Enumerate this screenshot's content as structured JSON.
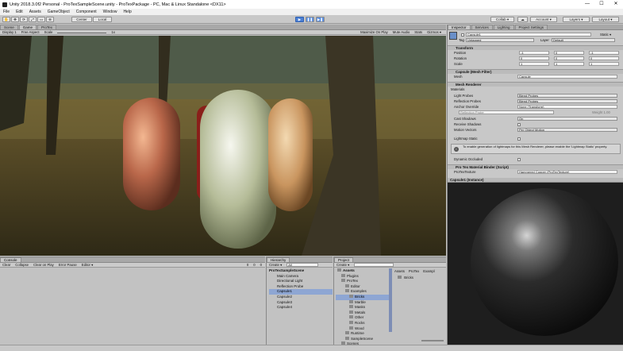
{
  "window": {
    "title": "Unity 2018.3.0f2 Personal - ProTexSampleScene.unity - ProTexPackage - PC, Mac & Linux Standalone <DX11>",
    "minimize": "—",
    "maximize": "☐",
    "close": "✕"
  },
  "menu": [
    "File",
    "Edit",
    "Assets",
    "GameObject",
    "Component",
    "Window",
    "Help"
  ],
  "toolbar": {
    "pivot": "Center",
    "space": "Local",
    "collab": "Collab ▾",
    "account": "Account ▾",
    "layers": "Layers ▾",
    "layout": "Layout ▾"
  },
  "scene_tabs": [
    "Scene",
    "Game",
    "ProTex"
  ],
  "game_bar": {
    "display": "Display 1",
    "aspect": "Free Aspect",
    "scale_label": "Scale",
    "scale_value": "1x",
    "maximize": "Maximize On Play",
    "mute": "Mute Audio",
    "stats": "Stats",
    "gizmos": "Gizmos ▾"
  },
  "inspector": {
    "tabs": [
      "Inspector",
      "Services",
      "Lighting",
      "Project Settings"
    ],
    "object_name": "Capsule1",
    "static": "Static ▾",
    "tag_label": "Tag",
    "tag_value": "Untagged",
    "layer_label": "Layer",
    "layer_value": "Default",
    "transform": {
      "title": "Transform",
      "rows": [
        {
          "label": "Position",
          "x": "-1",
          "y": "0",
          "z": "-1"
        },
        {
          "label": "Rotation",
          "x": "0",
          "y": "0",
          "z": "0"
        },
        {
          "label": "Scale",
          "x": "1",
          "y": "1",
          "z": "1"
        }
      ]
    },
    "mesh_filter": {
      "title": "Capsule (Mesh Filter)",
      "mesh_label": "Mesh",
      "mesh_value": "Capsule"
    },
    "mesh_renderer": {
      "title": "Mesh Renderer",
      "materials": "Materials",
      "rows": [
        {
          "label": "Light Probes",
          "value": "Blend Probes"
        },
        {
          "label": "Reflection Probes",
          "value": "Blend Probes"
        },
        {
          "label": "Anchor Override",
          "value": "None (Transform)"
        },
        {
          "label": "Cast Shadows",
          "value": "On"
        },
        {
          "label": "Receive Shadows",
          "value": ""
        },
        {
          "label": "Motion Vectors",
          "value": "Per Object Motion"
        },
        {
          "label": "Lightmap Static",
          "value": ""
        }
      ],
      "probe_label": "Reflection Probe",
      "probe_value": "Weight 1.00",
      "info": "To enable generation of lightmaps for this Mesh Renderer, please enable the 'Lightmap Static' property.",
      "dynamic_occluded": "Dynamic Occluded"
    },
    "protex": {
      "title": "Pro Tex Material Binder (Script)",
      "field_label": "ProTexTexture",
      "field_value": "Hammered Copper (ProTexTexture)"
    },
    "preview_title": "Capsule1 (Instance)"
  },
  "console": {
    "tab": "Console",
    "buttons": [
      "Clear",
      "Collapse",
      "Clear on Play",
      "Error Pause",
      "Editor ▾"
    ],
    "counts": [
      "0",
      "0",
      "0"
    ]
  },
  "hierarchy": {
    "tab": "Hierarchy",
    "create": "Create ▾",
    "search": "All",
    "scene": "ProTexSampleScene",
    "items": [
      "Main Camera",
      "Directional Light",
      "Reflection Probe",
      "Capsule1",
      "Capsule2",
      "Capsule3",
      "Capsule4"
    ],
    "selected": 3
  },
  "project": {
    "tab": "Project",
    "create": "Create ▾",
    "tree": [
      {
        "t": "Assets",
        "d": 0,
        "b": true
      },
      {
        "t": "Plugins",
        "d": 1
      },
      {
        "t": "ProTex",
        "d": 1
      },
      {
        "t": "Editor",
        "d": 2
      },
      {
        "t": "Examples",
        "d": 2
      },
      {
        "t": "Bricks",
        "d": 3,
        "s": true
      },
      {
        "t": "Marble",
        "d": 3
      },
      {
        "t": "Masks",
        "d": 3
      },
      {
        "t": "Metals",
        "d": 3
      },
      {
        "t": "Other",
        "d": 3
      },
      {
        "t": "Rocks",
        "d": 3
      },
      {
        "t": "Wood",
        "d": 3
      },
      {
        "t": "Runtime",
        "d": 2
      },
      {
        "t": "SampleScene",
        "d": 2
      },
      {
        "t": "Scenes",
        "d": 1
      }
    ],
    "breadcrumb": [
      "Assets",
      "ProTex",
      "Exampl"
    ],
    "folder_item": "Bricks"
  },
  "colors": {
    "accent": "#4a7fd4",
    "selection": "#8ea6d3"
  }
}
